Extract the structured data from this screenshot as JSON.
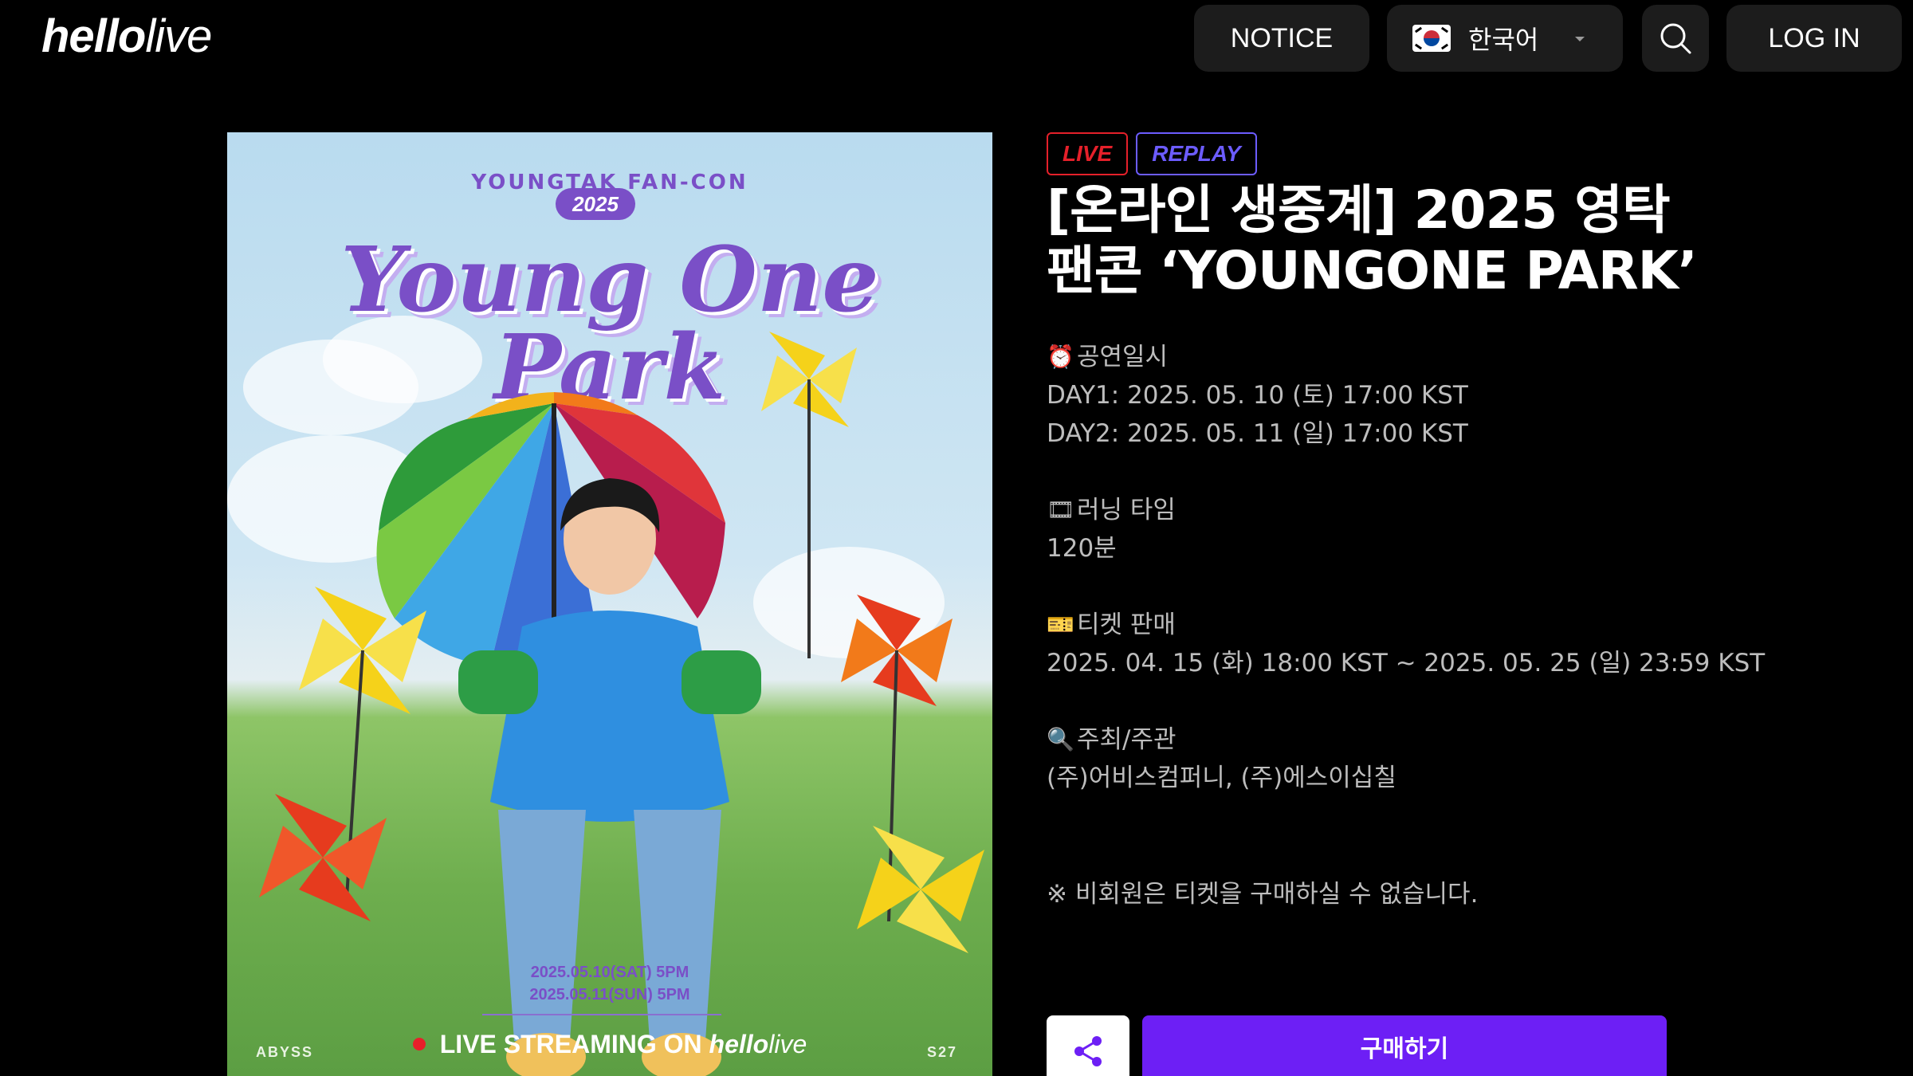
{
  "header": {
    "logo_bold": "hello",
    "logo_light": "live",
    "notice_label": "NOTICE",
    "language_label": "한국어",
    "login_label": "LOG IN"
  },
  "poster": {
    "fancon_label": "YOUNGTAK FAN-CON",
    "year": "2025",
    "title_line1": "Young One",
    "title_line2": "Park",
    "date1": "2025.05.10(SAT) 5PM",
    "date2": "2025.05.11(SUN) 5PM",
    "streaming_prefix": "LIVE STREAMING ON ",
    "streaming_brand_bold": "hello",
    "streaming_brand_light": "live",
    "left_corner_logo": "ABYSS",
    "right_corner_logo": "S27"
  },
  "event": {
    "badges": [
      "LIVE",
      "REPLAY"
    ],
    "title": "[온라인 생중계] 2025 영탁 팬콘 ‘YOUNGONE PARK’",
    "schedule": {
      "icon": "alarm-clock-icon",
      "label": "공연일시",
      "day1": "DAY1: 2025. 05. 10 (토) 17:00 KST",
      "day2": "DAY2: 2025. 05. 11 (일) 17:00 KST"
    },
    "running_time": {
      "icon": "film-icon",
      "label": "러닝 타임",
      "value": "120분"
    },
    "ticket_sale": {
      "icon": "ticket-icon",
      "label": "티켓 판매",
      "value": "2025. 04. 15 (화) 18:00 KST ~ 2025. 05. 25 (일) 23:59 KST"
    },
    "organizer": {
      "icon": "magnifier-icon",
      "label": "주최/주관",
      "value": "(주)어비스컴퍼니, (주)에스이십칠"
    },
    "member_notice": "※ 비회원은 티켓을 구매하실 수 없습니다.",
    "buy_label": "구매하기"
  },
  "colors": {
    "background": "#000000",
    "live_badge": "#e5202a",
    "replay_badge": "#6c5cff",
    "buy_button": "#6d1ff5"
  }
}
